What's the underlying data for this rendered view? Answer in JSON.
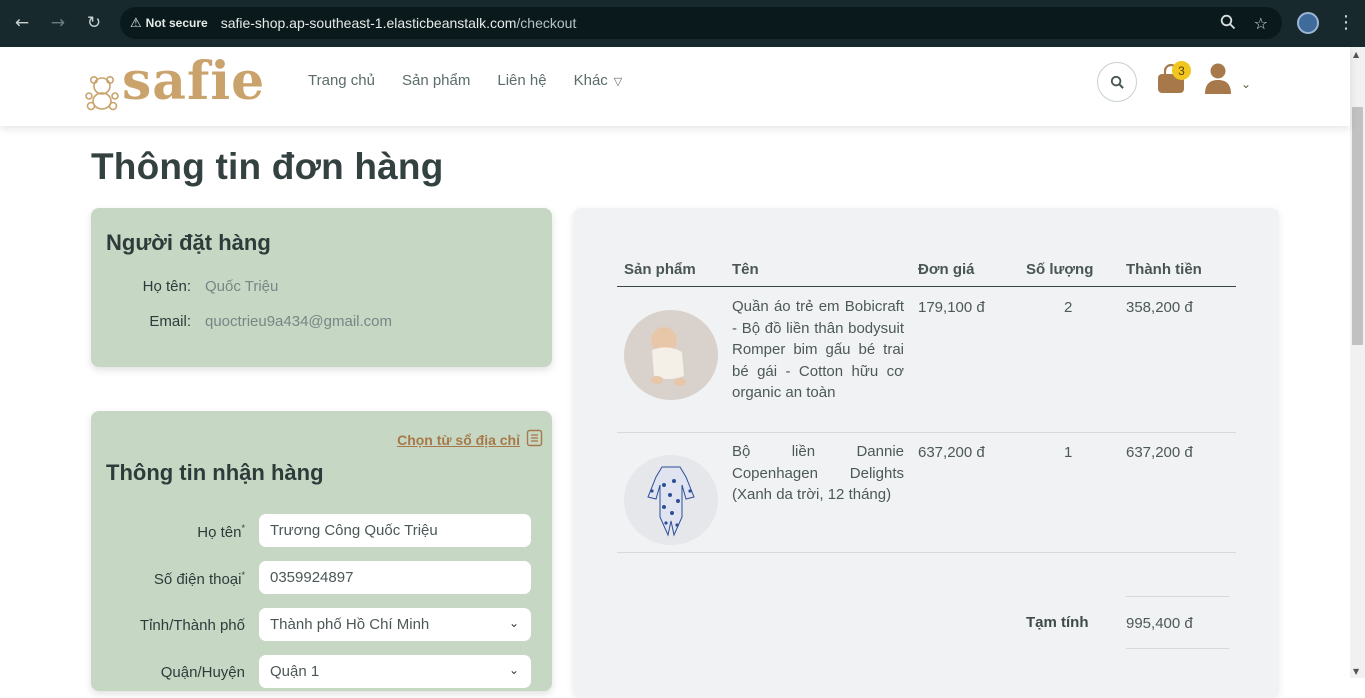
{
  "browser": {
    "security_label": "Not secure",
    "url_host": "safie-shop.ap-southeast-1.elasticbeanstalk.com",
    "url_path": "/checkout"
  },
  "header": {
    "logo_text": "safie",
    "nav": [
      "Trang chủ",
      "Sản phẩm",
      "Liên hệ",
      "Khác"
    ],
    "cart_count": "3"
  },
  "page_title": "Thông tin đơn hàng",
  "orderer": {
    "title": "Người đặt hàng",
    "name_label": "Họ tên:",
    "name_value": "Quốc Triệu",
    "email_label": "Email:",
    "email_value": "quoctrieu9a434@gmail.com"
  },
  "receiver": {
    "title": "Thông tin nhận hàng",
    "address_book_link": "Chọn từ sổ địa chỉ",
    "fields": [
      {
        "label": "Họ tên",
        "required": "*",
        "value": "Trương Công Quốc Triệu"
      },
      {
        "label": "Số điện thoại",
        "required": "*",
        "value": "0359924897"
      },
      {
        "label": "Tỉnh/Thành phố",
        "required": "",
        "value": "Thành phố Hồ Chí Minh"
      },
      {
        "label": "Quận/Huyện",
        "required": "",
        "value": "Quận 1"
      }
    ]
  },
  "order_table": {
    "headers": [
      "Sản phẩm",
      "Tên",
      "Đơn giá",
      "Số lượng",
      "Thành tiền"
    ],
    "rows": [
      {
        "name": "Quần áo trẻ em Bobicraft - Bộ đồ liền thân bodysuit Romper bim gấu bé trai bé gái - Cotton hữu cơ organic an toàn",
        "unit_price": "179,100 đ",
        "quantity": "2",
        "total": "358,200 đ"
      },
      {
        "name": "Bộ liền Dannie Copenhagen Delights (Xanh da trời, 12 tháng)",
        "unit_price": "637,200 đ",
        "quantity": "1",
        "total": "637,200 đ"
      }
    ],
    "subtotal_label": "Tạm tính",
    "subtotal_value": "995,400 đ"
  },
  "colors": {
    "brand": "#a7794a",
    "card_green": "#c6d8c4",
    "badge": "#f2c61f"
  }
}
